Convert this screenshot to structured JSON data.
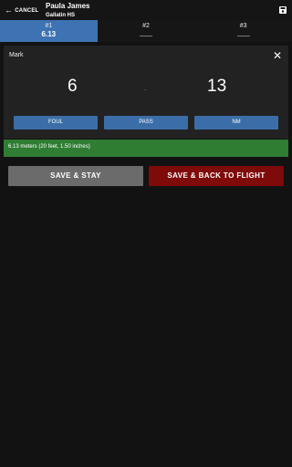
{
  "header": {
    "cancel_label": "CANCEL",
    "athlete_name": "Paula James",
    "school": "Gallatin HS",
    "icons": {
      "back": "arrow-left-icon",
      "save": "floppy-disk-icon"
    }
  },
  "tabs": [
    {
      "label": "#1",
      "value": "6.13",
      "active": true
    },
    {
      "label": "#2",
      "value": "",
      "active": false
    },
    {
      "label": "#3",
      "value": "",
      "active": false
    }
  ],
  "mark_panel": {
    "title": "Mark",
    "whole": "6",
    "separator": ".",
    "fraction": "13",
    "buttons": {
      "foul": "FOUL",
      "pass": "PASS",
      "nm": "NM"
    }
  },
  "result": {
    "text": "6.13 meters (20 feet, 1.50 inches)"
  },
  "actions": {
    "save_stay": "SAVE & STAY",
    "save_back": "SAVE & BACK TO FLIGHT"
  },
  "colors": {
    "accent": "#3d73b2",
    "success": "#2f7d32",
    "danger": "#7f0a0a",
    "neutral": "#6b6b6b"
  }
}
